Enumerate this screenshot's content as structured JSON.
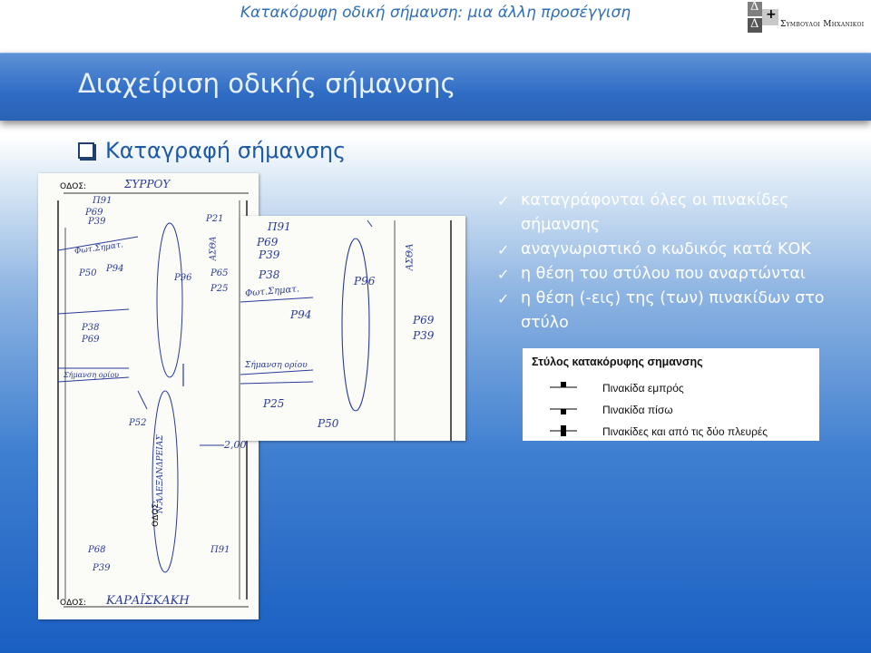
{
  "top_title": "Κατακόρυφη οδική σήμανση: μια άλλη προσέγγιση",
  "logo": {
    "l1": "Δ",
    "l2": "+",
    "l3": "Δ",
    "text": "Συμβουλοι Μηχανικοι"
  },
  "header": {
    "title": "Διαχείριση οδικής σήμανσης"
  },
  "section": {
    "title": "Καταγραφή σήμανσης"
  },
  "bullets": [
    "καταγράφονται όλες οι πινακίδες σήμανσης",
    "αναγνωριστικό ο κωδικός κατά ΚΟΚ",
    "η θέση του στύλου που αναρτώνται",
    "η θέση (-εις) της (των) πινακίδων στο στύλο"
  ],
  "legend": {
    "title": "Στύλος κατακόρυφης σημανσης",
    "rows": [
      {
        "label": "Πινακίδα εμπρός",
        "icon": "sign-front"
      },
      {
        "label": "Πινακίδα πίσω",
        "icon": "sign-back"
      },
      {
        "label": "Πινακίδες και από τις δύο πλευρές",
        "icon": "sign-both"
      }
    ]
  },
  "sketch1": {
    "odos_label_top": "ΟΔΟΣ:",
    "street_top": "ΣΥΡΡΟΥ",
    "odos_label_bottom": "ΟΔΟΣ:",
    "street_bottom": "ΚΑΡΑΪΣΚΑΚΗ",
    "odos_label_side": "ΟΔΟΣ:",
    "street_side": "Ν.ΑΛΕΞΑΝΔΡΕΙΑΣ",
    "codes": [
      "Π91",
      "Ρ69",
      "Ρ39",
      "Ρ21",
      "Ρ50",
      "Ρ65",
      "Ρ96",
      "Ρ25",
      "Ρ38",
      "Ρ69",
      "Ρ39",
      "Π91",
      "Ρ94",
      "Ρ68",
      "Ρ52"
    ],
    "notes": [
      "ΑΣΘΑ",
      "Φωτ.Σηματ.",
      "Σήμανση ορίου",
      "2,00"
    ]
  },
  "sketch2": {
    "codes": [
      "Π91",
      "Ρ69",
      "Ρ39",
      "Ρ38",
      "Ρ96",
      "Ρ69",
      "Ρ39",
      "Ρ25",
      "Ρ50",
      "Ρ94"
    ],
    "notes": [
      "ΑΣΘΑ",
      "Φωτ.Σηματ.",
      "Σήμανση ορίου"
    ]
  },
  "colors": {
    "accent": "#2f6cc4",
    "title_blue": "#2e6fb8",
    "ink": "#2a3a9a"
  }
}
